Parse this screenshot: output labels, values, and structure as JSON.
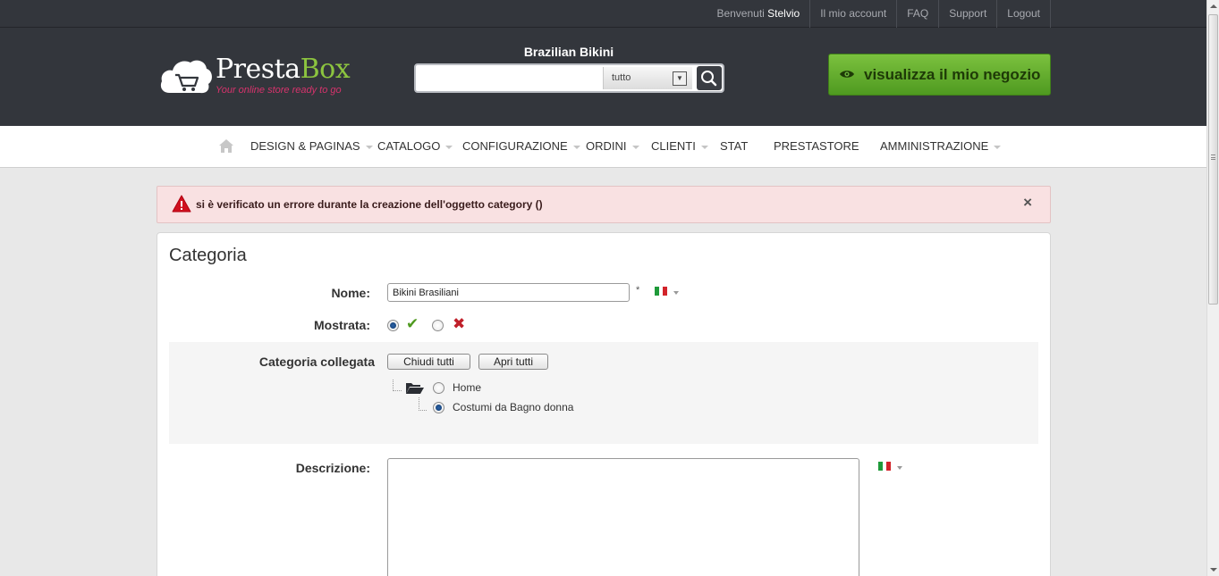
{
  "userbar": {
    "welcome_prefix": "Benvenuti",
    "username": "Stelvio",
    "links": [
      "Il mio account",
      "FAQ",
      "Support",
      "Logout"
    ]
  },
  "header": {
    "logo_name_main": "Presta",
    "logo_name_accent": "Box",
    "logo_tagline": "Your online store ready to go",
    "search_title": "Brazilian Bikini",
    "search_value": "",
    "search_scope": "tutto",
    "shop_button_label": "visualizza il mio negozio"
  },
  "nav": {
    "items": [
      {
        "label": "DESIGN & PAGINAS",
        "dropdown": true
      },
      {
        "label": "CATALOGO",
        "dropdown": true
      },
      {
        "label": "CONFIGURAZIONE",
        "dropdown": true
      },
      {
        "label": "ORDINI",
        "dropdown": true
      },
      {
        "label": "CLIENTI",
        "dropdown": true
      },
      {
        "label": "STAT",
        "dropdown": false
      },
      {
        "label": "PRESTASTORE",
        "dropdown": false
      },
      {
        "label": "AMMINISTRAZIONE",
        "dropdown": true
      }
    ]
  },
  "error": {
    "message": "si è verificato un errore durante la creazione dell'oggetto category ()",
    "close": "×"
  },
  "form": {
    "title": "Categoria",
    "name_label": "Nome:",
    "name_value": "Bikini Brasiliani",
    "required_marker": "*",
    "displayed_label": "Mostrata:",
    "displayed_value": "yes",
    "parent_label": "Categoria collegata",
    "collapse_all": "Chiudi tutti",
    "expand_all": "Apri tutti",
    "tree": [
      {
        "label": "Home",
        "selected": false
      },
      {
        "label": "Costumi da Bagno donna",
        "selected": true
      }
    ],
    "description_label": "Descrizione:",
    "description_value": ""
  },
  "colors": {
    "header_bg": "#33363c",
    "accent_green": "#6cb33e",
    "error_bg": "#f9e1e2",
    "logo_tagline": "#d6336c"
  }
}
